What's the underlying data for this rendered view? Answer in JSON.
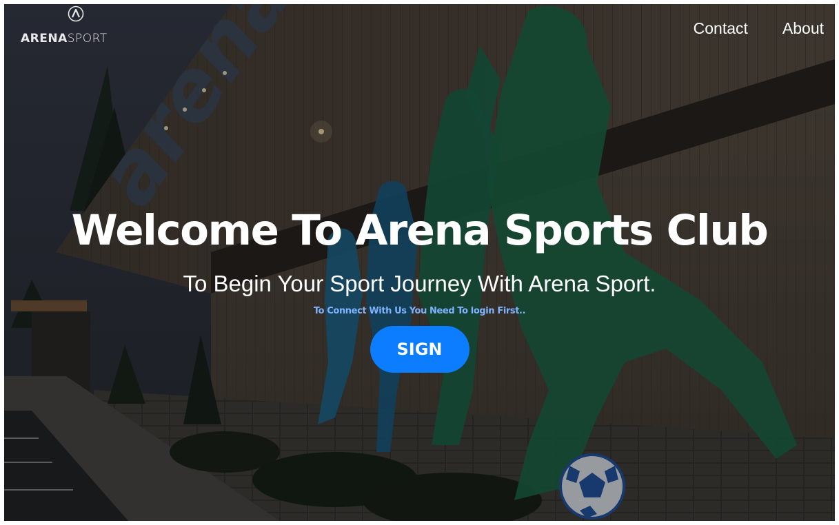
{
  "brand": {
    "logo_bold": "ARENA",
    "logo_light": "SPORT",
    "logo_icon": "arena-a-icon"
  },
  "nav": {
    "items": [
      {
        "label": "Contact"
      },
      {
        "label": "About"
      }
    ]
  },
  "hero": {
    "title": "Welcome To Arena Sports Club",
    "subtitle": "To Begin Your Sport Journey With Arena Sport.",
    "note": "To Connect With Us You Need To login First..",
    "button_label": "SIGN"
  },
  "colors": {
    "button": "#0d7dff",
    "note": "#7db3ff",
    "text": "#ffffff",
    "mural_green": "#1d6b4f",
    "mural_blue": "#1f6f99"
  }
}
